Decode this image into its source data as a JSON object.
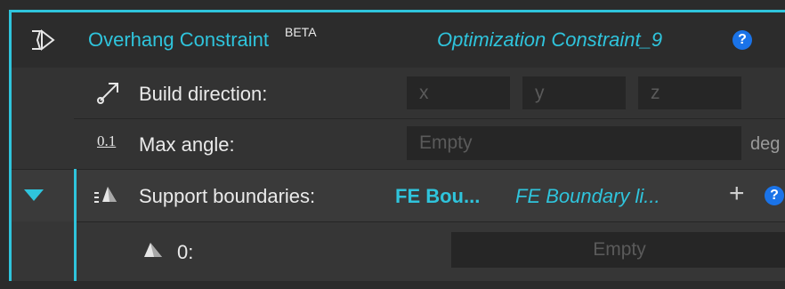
{
  "header": {
    "icon": "overhang-icon",
    "title": "Overhang Constraint",
    "badge": "BETA",
    "name": "Optimization Constraint_9",
    "help": "?"
  },
  "build_direction": {
    "icon": "arrow-direction-icon",
    "label": "Build direction:",
    "x_placeholder": "x",
    "y_placeholder": "y",
    "z_placeholder": "z"
  },
  "max_angle": {
    "icon_text": "0.1",
    "label": "Max angle:",
    "placeholder": "Empty",
    "unit": "deg"
  },
  "support_boundaries": {
    "expand_icon": "triangle-down-icon",
    "icon": "boundary-cone-icon",
    "label": "Support boundaries:",
    "value": "FE Bou...",
    "value_italic": "FE Boundary li...",
    "add": "+",
    "help": "?"
  },
  "boundary_item": {
    "icon": "cone-icon",
    "label": "0:",
    "placeholder": "Empty"
  },
  "colors": {
    "accent": "#2fc4dc",
    "help_blue": "#1a73e8"
  }
}
